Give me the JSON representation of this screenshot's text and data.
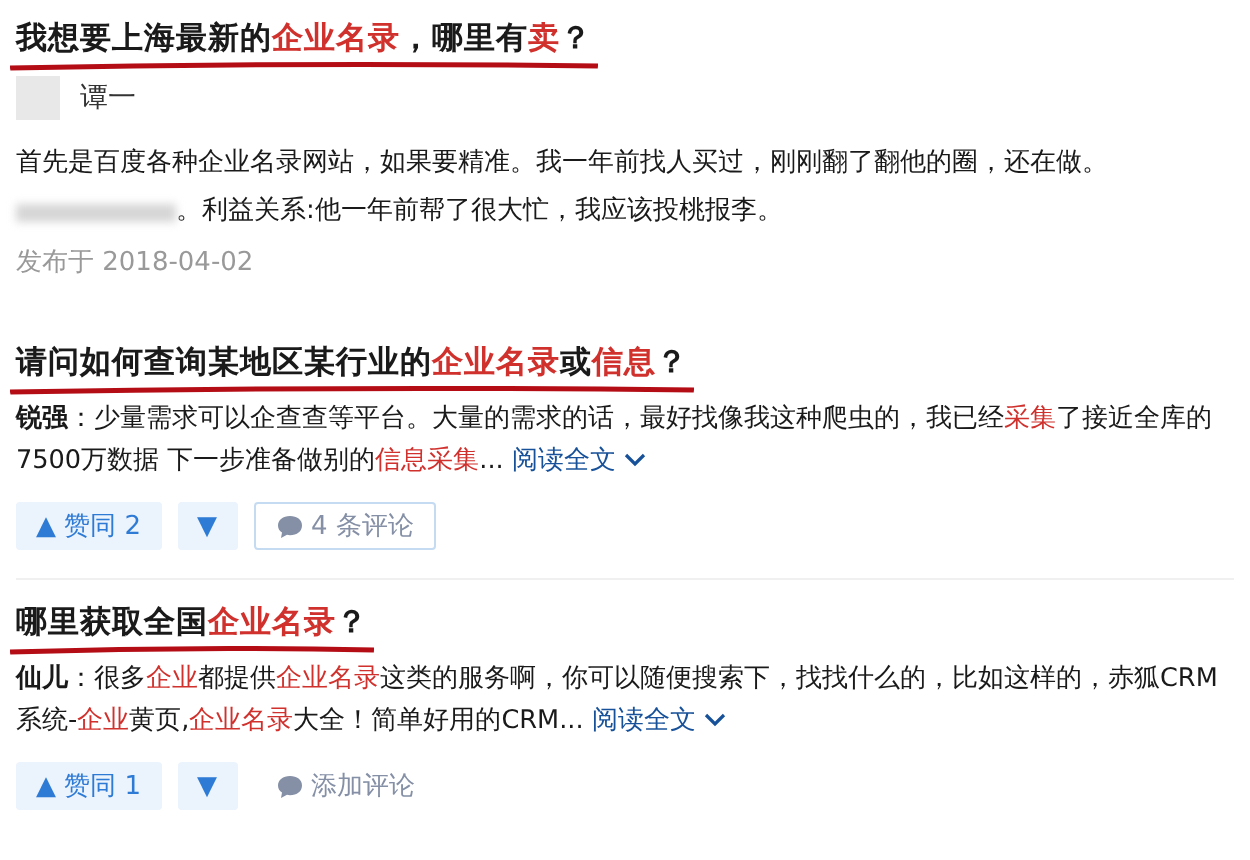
{
  "items": [
    {
      "kind": "post",
      "title": [
        {
          "text": "我想要上海最新的",
          "highlight": false
        },
        {
          "text": "企业名录",
          "highlight": true
        },
        {
          "text": "，哪里有",
          "highlight": false
        },
        {
          "text": "卖",
          "highlight": true
        },
        {
          "text": "？",
          "highlight": false
        }
      ],
      "author": "谭一",
      "body_lines": [
        [
          {
            "kind": "text",
            "text": "首先是百度各种企业名录网站，如果要精准。我一年前找人买过，刚刚翻了翻他的圈，还在做。"
          }
        ],
        [
          {
            "kind": "redacted"
          },
          {
            "kind": "text",
            "text": "。利益关系:他一年前帮了很大忙，我应该投桃报李。"
          }
        ]
      ],
      "date": "发布于 2018-04-02"
    },
    {
      "kind": "answer",
      "title": [
        {
          "text": "请问如何查询某地区某行业的",
          "highlight": false
        },
        {
          "text": "企业名录",
          "highlight": true
        },
        {
          "text": "或",
          "highlight": false
        },
        {
          "text": "信息",
          "highlight": true
        },
        {
          "text": "？",
          "highlight": false
        }
      ],
      "author": "锐强",
      "excerpt": [
        {
          "text": "：少量需求可以企查查等平台。大量的需求的话，最好找像我这种爬虫的，我已经",
          "highlight": false
        },
        {
          "text": "采集",
          "highlight": true
        },
        {
          "text": "了接近全库的7500万数据 下一步准备做别的",
          "highlight": false
        },
        {
          "text": "信息采集",
          "highlight": true
        },
        {
          "text": "...",
          "highlight": false
        }
      ],
      "read_more": "阅读全文",
      "upvote": "▲ 赞同 2",
      "downvote": "▼",
      "comment": {
        "label": "4 条评论",
        "highlighted": true
      }
    },
    {
      "kind": "answer",
      "title": [
        {
          "text": "哪里获取全国",
          "highlight": false
        },
        {
          "text": "企业名录",
          "highlight": true
        },
        {
          "text": "？",
          "highlight": false
        }
      ],
      "author": "仙儿",
      "excerpt": [
        {
          "text": "：很多",
          "highlight": false
        },
        {
          "text": "企业",
          "highlight": true
        },
        {
          "text": "都提供",
          "highlight": false
        },
        {
          "text": "企业名录",
          "highlight": true
        },
        {
          "text": "这类的服务啊，你可以随便搜索下，找找什么的，比如这样的，赤狐CRM系统-",
          "highlight": false
        },
        {
          "text": "企业",
          "highlight": true
        },
        {
          "text": "黄页,",
          "highlight": false
        },
        {
          "text": "企业名录",
          "highlight": true
        },
        {
          "text": "大全！简单好用的CRM...",
          "highlight": false
        }
      ],
      "read_more": "阅读全文",
      "upvote": "▲ 赞同 1",
      "downvote": "▼",
      "comment": {
        "label": "添加评论",
        "highlighted": false
      }
    }
  ]
}
